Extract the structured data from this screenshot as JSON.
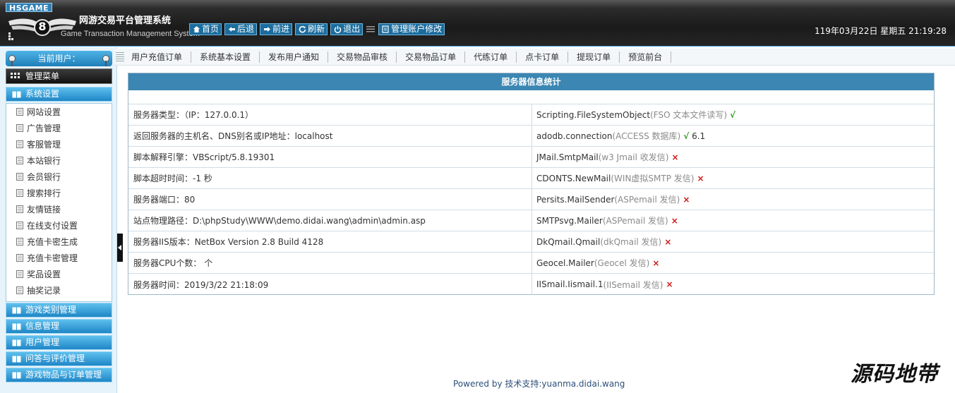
{
  "header": {
    "brand_tag": "HSGAME",
    "logo_badge": "8",
    "title": "网游交易平台管理系统",
    "subtitle": "Game Transaction Management System",
    "nav": [
      {
        "label": "首页",
        "icon": "home-icon"
      },
      {
        "label": "后退",
        "icon": "arrow-left-icon"
      },
      {
        "label": "前进",
        "icon": "arrow-right-icon"
      },
      {
        "label": "刷新",
        "icon": "refresh-icon"
      },
      {
        "label": "退出",
        "icon": "power-icon"
      }
    ],
    "account_label": "管理账户修改",
    "datetime": "119年03月22日 星期五 21:19:28"
  },
  "sidebar": {
    "current_user_label": "当前用户：",
    "menu_title": "管理菜单",
    "groups": [
      {
        "label": "系统设置"
      },
      {
        "label": "游戏类别管理"
      },
      {
        "label": "信息管理"
      },
      {
        "label": "用户管理"
      },
      {
        "label": "问答与评价管理"
      },
      {
        "label": "游戏物品与订单管理"
      }
    ],
    "items": [
      "网站设置",
      "广告管理",
      "客服管理",
      "本站银行",
      "会员银行",
      "搜索排行",
      "友情链接",
      "在线支付设置",
      "充值卡密生成",
      "充值卡密管理",
      "奖品设置",
      "抽奖记录"
    ]
  },
  "tabs": [
    "用户充值订单",
    "系统基本设置",
    "发布用户通知",
    "交易物品审核",
    "交易物品订单",
    "代练订单",
    "点卡订单",
    "提现订单",
    "预览前台"
  ],
  "panel": {
    "title": "服务器信息统计",
    "rows": [
      {
        "left": "服务器类型：（IP：127.0.0.1）",
        "comp": "Scripting.FileSystemObject",
        "desc": "(FSO 文本文件读写)",
        "status": "ok",
        "mark": "√",
        "extra": ""
      },
      {
        "left": "返回服务器的主机名、DNS别名或IP地址：localhost",
        "comp": "adodb.connection",
        "desc": "(ACCESS 数据库)",
        "status": "ok",
        "mark": "√",
        "extra": " 6.1"
      },
      {
        "left": "脚本解释引擎：VBScript/5.8.19301",
        "comp": "JMail.SmtpMail",
        "desc": "(w3 Jmail 收发信)",
        "status": "bad",
        "mark": "×",
        "extra": ""
      },
      {
        "left": "脚本超时时间：-1 秒",
        "comp": "CDONTS.NewMail",
        "desc": "(WIN虚拟SMTP 发信)",
        "status": "bad",
        "mark": "×",
        "extra": ""
      },
      {
        "left": "服务器端口：80",
        "comp": "Persits.MailSender",
        "desc": "(ASPemail 发信)",
        "status": "bad",
        "mark": "×",
        "extra": ""
      },
      {
        "left": "站点物理路径：D:\\phpStudy\\WWW\\demo.didai.wang\\admin\\admin.asp",
        "comp": "SMTPsvg.Mailer",
        "desc": "(ASPemail 发信)",
        "status": "bad",
        "mark": "×",
        "extra": ""
      },
      {
        "left": "服务器IIS版本：NetBox Version 2.8 Build 4128",
        "comp": "DkQmail.Qmail",
        "desc": "(dkQmail 发信)",
        "status": "bad",
        "mark": "×",
        "extra": ""
      },
      {
        "left": "服务器CPU个数： 个",
        "comp": "Geocel.Mailer",
        "desc": "(Geocel 发信)",
        "status": "bad",
        "mark": "×",
        "extra": ""
      },
      {
        "left": "服务器时间：2019/3/22 21:18:09",
        "comp": "IISmail.Iismail.1",
        "desc": "(IISemail 发信)",
        "status": "bad",
        "mark": "×",
        "extra": ""
      }
    ]
  },
  "footer": "Powered by 技术支持:yuanma.didai.wang",
  "watermark": "源码地带",
  "colors": {
    "accent": "#3b86b2",
    "ok": "#2a9a1a",
    "bad": "#d01818"
  }
}
